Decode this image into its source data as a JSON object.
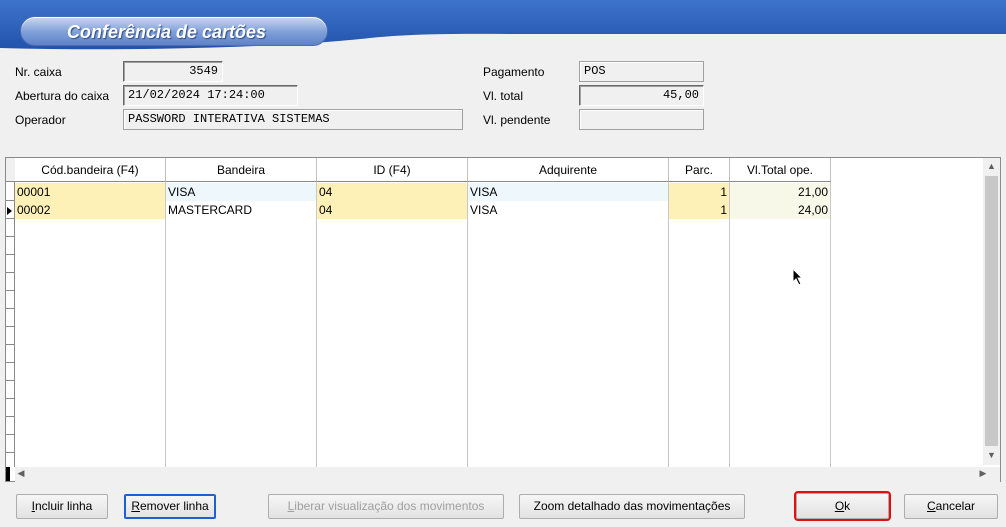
{
  "window": {
    "title": "Conferência de cartões"
  },
  "form": {
    "nr_caixa_label": "Nr. caixa",
    "nr_caixa_value": "3549",
    "abertura_label": "Abertura do caixa",
    "abertura_value": "21/02/2024 17:24:00",
    "operador_label": "Operador",
    "operador_value": "PASSWORD INTERATIVA SISTEMAS",
    "pagamento_label": "Pagamento",
    "pagamento_value": "POS",
    "vl_total_label": "Vl. total",
    "vl_total_value": "45,00",
    "vl_pendente_label": "Vl. pendente",
    "vl_pendente_value": ""
  },
  "grid": {
    "columns": [
      "Cód.bandeira (F4)",
      "Bandeira",
      "ID (F4)",
      "Adquirente",
      "Parc.",
      "Vl.Total ope."
    ],
    "rows": [
      {
        "cod_bandeira": "00001",
        "bandeira": "VISA",
        "id": "04",
        "adquirente": "VISA",
        "parc": "1",
        "vl_total": "21,00"
      },
      {
        "cod_bandeira": "00002",
        "bandeira": "MASTERCARD",
        "id": "04",
        "adquirente": "VISA",
        "parc": "1",
        "vl_total": "24,00"
      }
    ]
  },
  "buttons": {
    "incluir": {
      "first": "I",
      "rest": "ncluir linha"
    },
    "remover": {
      "first": "R",
      "rest": "emover linha"
    },
    "liberar": {
      "first": "L",
      "rest": "iberar visualização dos movimentos"
    },
    "zoom": "Zoom detalhado das movimentações",
    "ok": {
      "first": "O",
      "rest": "k"
    },
    "cancelar": {
      "first": "C",
      "rest": "ancelar"
    }
  },
  "colors": {
    "header_blue": "#2d5fb8",
    "row_yellow": "#fdf1b8",
    "ok_outline": "#e01010"
  }
}
